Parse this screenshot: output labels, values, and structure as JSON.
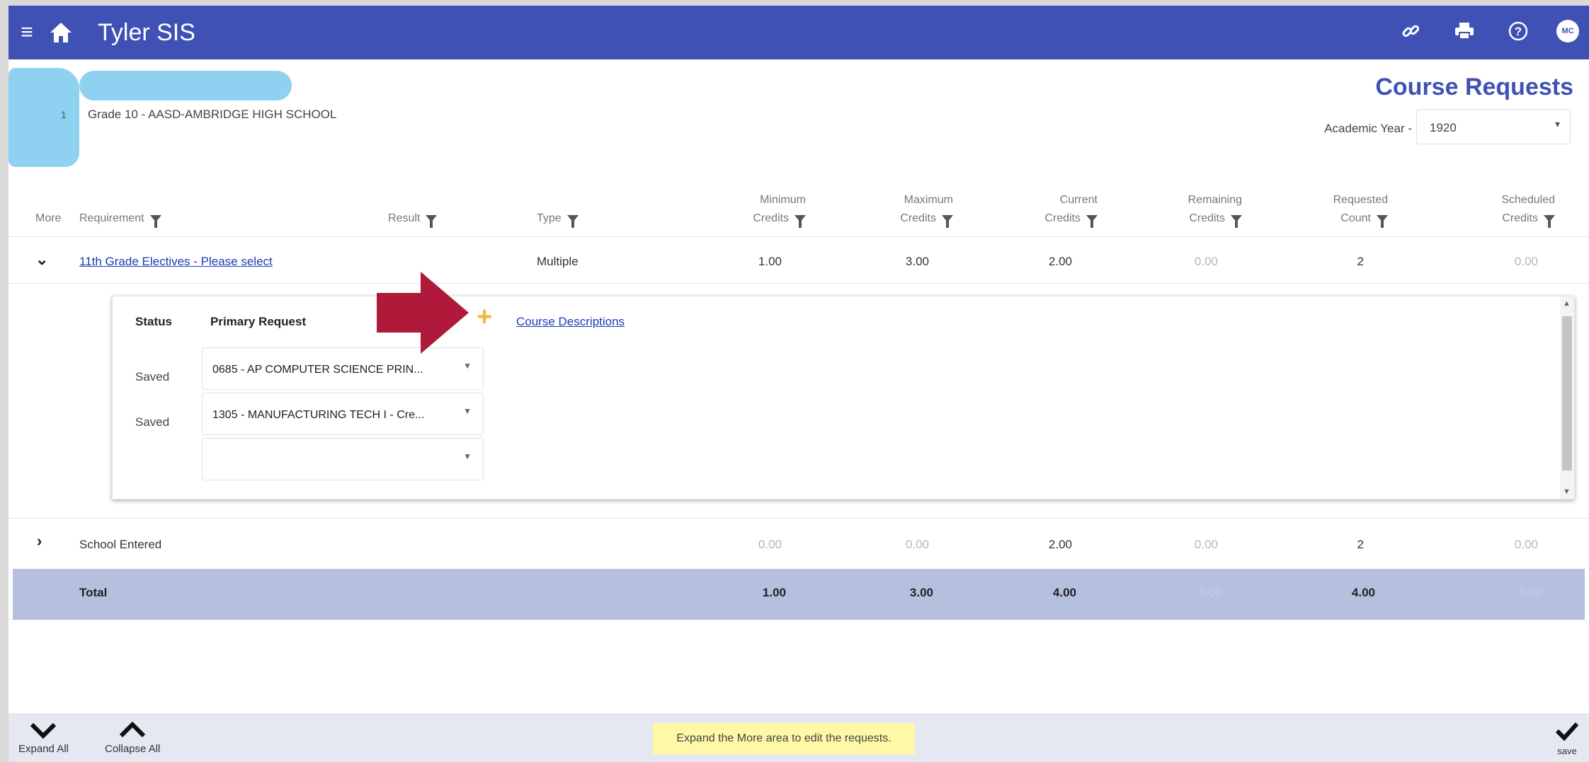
{
  "app": {
    "title": "Tyler SIS"
  },
  "student": {
    "number": "1",
    "grade_school": "Grade 10 - AASD-AMBRIDGE HIGH SCHOOL"
  },
  "user": {
    "initials": "MC"
  },
  "page": {
    "title": "Course Requests",
    "academic_year_label": "Academic Year -",
    "academic_year_value": "1920"
  },
  "table": {
    "headers": {
      "more": "More",
      "requirement": "Requirement",
      "result": "Result",
      "type": "Type",
      "min_credits": [
        "Minimum",
        "Credits"
      ],
      "max_credits": [
        "Maximum",
        "Credits"
      ],
      "current_credits": [
        "Current",
        "Credits"
      ],
      "remaining_credits": [
        "Remaining",
        "Credits"
      ],
      "requested_count": [
        "Requested",
        "Count"
      ],
      "scheduled_credits": [
        "Scheduled",
        "Credits"
      ]
    },
    "rows": [
      {
        "requirement": "11th Grade Electives - Please select",
        "type": "Multiple",
        "min_credits": "1.00",
        "max_credits": "3.00",
        "current_credits": "2.00",
        "remaining_credits": "0.00",
        "requested_count": "2",
        "scheduled_credits": "0.00"
      },
      {
        "requirement": "School Entered",
        "type": "",
        "min_credits": "0.00",
        "max_credits": "0.00",
        "current_credits": "2.00",
        "remaining_credits": "0.00",
        "requested_count": "2",
        "scheduled_credits": "0.00"
      }
    ],
    "total": {
      "label": "Total",
      "min_credits": "1.00",
      "max_credits": "3.00",
      "current_credits": "4.00",
      "remaining_credits": "0.00",
      "requested_count": "4.00",
      "scheduled_credits": "0.00"
    }
  },
  "panel": {
    "status_header": "Status",
    "primary_header": "Primary Request",
    "course_descriptions": "Course Descriptions",
    "requests": [
      {
        "status": "Saved",
        "value": "0685 - AP COMPUTER SCIENCE PRIN..."
      },
      {
        "status": "Saved",
        "value": "1305 - MANUFACTURING TECH I - Cre..."
      },
      {
        "status": "",
        "value": ""
      }
    ]
  },
  "footer": {
    "expand_all": "Expand All",
    "collapse_all": "Collapse All",
    "hint": "Expand the More area to edit the requests.",
    "save": "save"
  },
  "icons": [
    "menu-icon",
    "home-icon",
    "link-icon",
    "print-icon",
    "help-icon",
    "expand-icon",
    "collapse-icon",
    "add-icon",
    "save-icon",
    "filter-icon"
  ],
  "colors": {
    "brand": "#3f51b5",
    "total_row": "#b5bfde",
    "hint_bg": "#fff8a6",
    "add_plus": "#f2b93b",
    "annotation_arrow": "#b01a3a"
  }
}
